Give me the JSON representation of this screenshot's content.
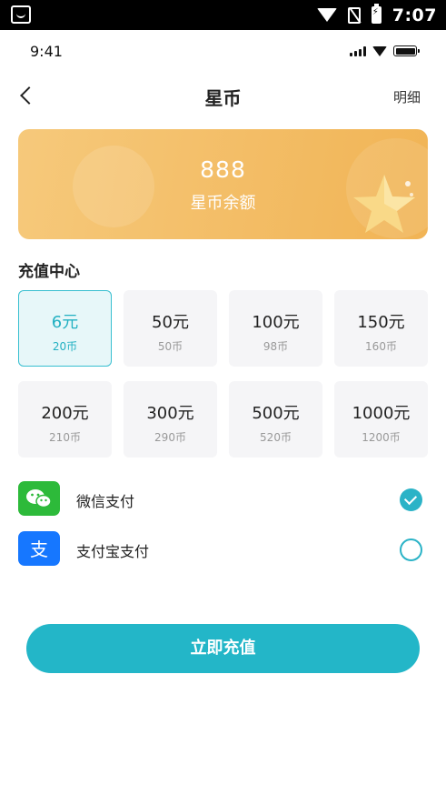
{
  "system_bar": {
    "time": "7:07"
  },
  "status_bar": {
    "time": "9:41"
  },
  "nav": {
    "title": "星币",
    "right_link": "明细"
  },
  "balance": {
    "amount": "888",
    "label": "星币余额"
  },
  "recharge": {
    "title": "充值中心",
    "selected_index": 0,
    "options": [
      {
        "price": "6元",
        "coins": "20币"
      },
      {
        "price": "50元",
        "coins": "50币"
      },
      {
        "price": "100元",
        "coins": "98币"
      },
      {
        "price": "150元",
        "coins": "160币"
      },
      {
        "price": "200元",
        "coins": "210币"
      },
      {
        "price": "300元",
        "coins": "290币"
      },
      {
        "price": "500元",
        "coins": "520币"
      },
      {
        "price": "1000元",
        "coins": "1200币"
      }
    ]
  },
  "payment": {
    "methods": [
      {
        "label": "微信支付",
        "icon": "wechat-icon",
        "selected": true
      },
      {
        "label": "支付宝支付",
        "icon": "alipay-icon",
        "selected": false
      }
    ]
  },
  "submit_label": "立即充值",
  "colors": {
    "accent": "#23b6c8",
    "card": "#f3bd66",
    "wechat": "#2dba3a",
    "alipay": "#1677ff"
  }
}
